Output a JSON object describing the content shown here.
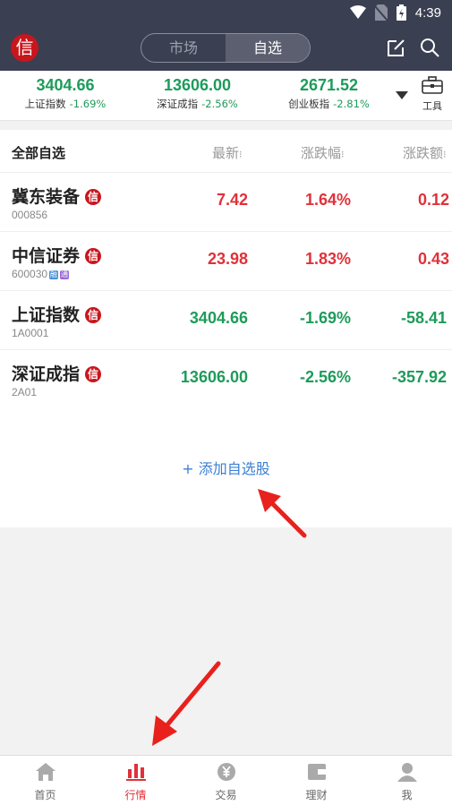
{
  "status_bar": {
    "time": "4:39"
  },
  "header": {
    "logo_text": "信",
    "tabs": [
      {
        "label": "市场",
        "active": false
      },
      {
        "label": "自选",
        "active": true
      }
    ],
    "icons": [
      "edit-icon",
      "search-icon"
    ]
  },
  "indices": [
    {
      "value": "3404.66",
      "name": "上证指数",
      "change": "-1.69%"
    },
    {
      "value": "13606.00",
      "name": "深证成指",
      "change": "-2.56%"
    },
    {
      "value": "2671.52",
      "name": "创业板指",
      "change": "-2.81%"
    }
  ],
  "tools_label": "工具",
  "list": {
    "title": "全部自选",
    "columns": [
      "最新",
      "涨跌幅",
      "涨跌额"
    ],
    "rows": [
      {
        "name": "冀东装备",
        "code": "000856",
        "price": "7.42",
        "pct": "1.64%",
        "amt": "0.12",
        "dir": "up",
        "badge": "信"
      },
      {
        "name": "中信证券",
        "code": "600030",
        "price": "23.98",
        "pct": "1.83%",
        "amt": "0.43",
        "dir": "up",
        "badge": "信",
        "tags": [
          "融",
          "通"
        ]
      },
      {
        "name": "上证指数",
        "code": "1A0001",
        "price": "3404.66",
        "pct": "-1.69%",
        "amt": "-58.41",
        "dir": "down",
        "badge": "信"
      },
      {
        "name": "深证成指",
        "code": "2A01",
        "price": "13606.00",
        "pct": "-2.56%",
        "amt": "-357.92",
        "dir": "down",
        "badge": "信"
      }
    ],
    "add_label": "+ 添加自选股"
  },
  "tabbar": [
    {
      "label": "首页",
      "icon": "home-icon",
      "active": false
    },
    {
      "label": "行情",
      "icon": "chart-icon",
      "active": true
    },
    {
      "label": "交易",
      "icon": "yen-icon",
      "active": false
    },
    {
      "label": "理财",
      "icon": "wallet-icon",
      "active": false
    },
    {
      "label": "我",
      "icon": "user-icon",
      "active": false
    }
  ],
  "colors": {
    "header_bg": "#3b3f52",
    "up": "#e0313a",
    "down": "#1e9b5a",
    "link": "#3c7fd6",
    "annotation_arrow": "#e8211d"
  }
}
